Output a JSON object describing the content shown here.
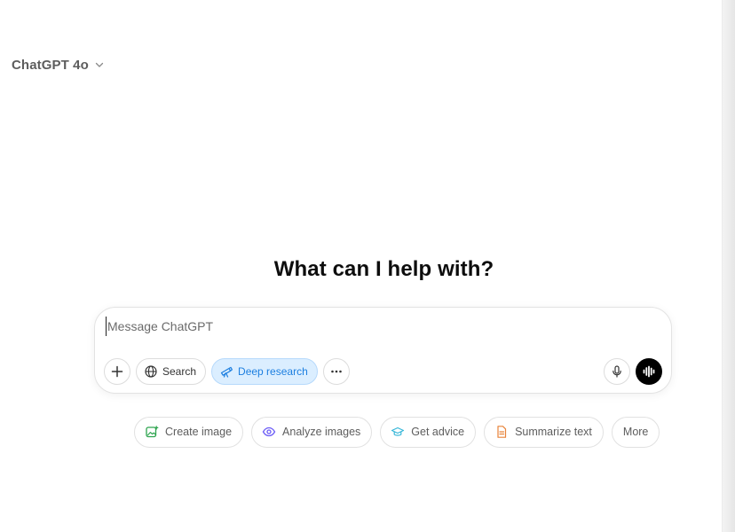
{
  "header": {
    "model_name": "ChatGPT 4o"
  },
  "main": {
    "heading": "What can I help with?"
  },
  "composer": {
    "placeholder": "Message ChatGPT",
    "value": "",
    "tools": {
      "search_label": "Search",
      "deep_research_label": "Deep research"
    }
  },
  "suggestions": [
    {
      "label": "Create image",
      "icon": "image-create-icon",
      "color": "#2da44e"
    },
    {
      "label": "Analyze images",
      "icon": "eye-icon",
      "color": "#6b5cf6"
    },
    {
      "label": "Get advice",
      "icon": "graduation-cap-icon",
      "color": "#36b6d8"
    },
    {
      "label": "Summarize text",
      "icon": "document-icon",
      "color": "#e8833a"
    },
    {
      "label": "More",
      "icon": "",
      "color": ""
    }
  ],
  "colors": {
    "accent_blue": "#1d7fe0",
    "active_pill_bg": "#dbeeff",
    "voice_button": "#000000"
  }
}
